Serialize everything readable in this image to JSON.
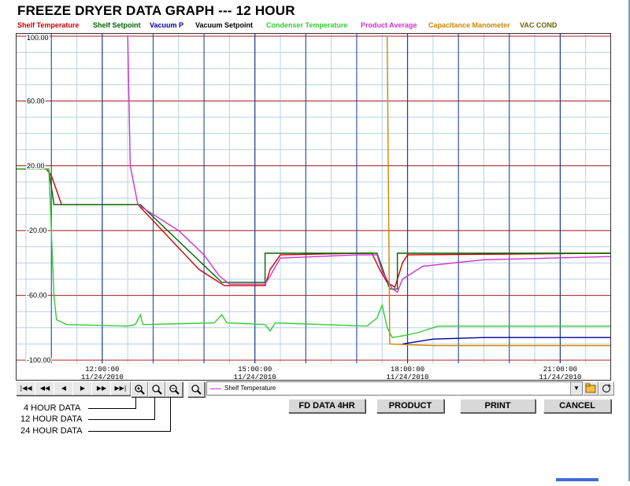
{
  "window": {
    "title": "FREEZE DRYER DATA GRAPH --- 12 HOUR"
  },
  "legend": [
    {
      "label": "Shelf Temperature",
      "color": "#cc0000"
    },
    {
      "label": "Shelf Setpoint",
      "color": "#006600"
    },
    {
      "label": "Vacuum P",
      "color": "#000099"
    },
    {
      "label": "Vacuum Setpoint",
      "color": "#000000"
    },
    {
      "label": "Condenser Temperature",
      "color": "#33cc33"
    },
    {
      "label": "Product Average",
      "color": "#cc33cc"
    },
    {
      "label": "Capacitance Manometer",
      "color": "#cc8800"
    },
    {
      "label": "VAC COND",
      "color": "#666600"
    }
  ],
  "chart_data": {
    "type": "line",
    "ylim": [
      -100,
      100
    ],
    "y_ticks": [
      "100.00",
      "60.00",
      "20.00",
      "-20.00",
      "-60.00",
      "-100.00"
    ],
    "x_ticks": [
      {
        "time": "12:00:00",
        "date": "11/24/2010"
      },
      {
        "time": "15:00:00",
        "date": "11/24/2010"
      },
      {
        "time": "18:00:00",
        "date": "11/24/2010"
      },
      {
        "time": "21:00:00",
        "date": "11/24/2010"
      }
    ],
    "xlim_hours": [
      10.3,
      22.0
    ],
    "grid": true,
    "series": [
      {
        "name": "Shelf Temperature",
        "color": "#cc0000",
        "points": [
          [
            10.3,
            18
          ],
          [
            10.9,
            18
          ],
          [
            11.0,
            14
          ],
          [
            11.2,
            -4
          ],
          [
            12.7,
            -4
          ],
          [
            13.9,
            -44
          ],
          [
            14.4,
            -54
          ],
          [
            15.2,
            -54
          ],
          [
            15.3,
            -44
          ],
          [
            15.5,
            -35
          ],
          [
            17.0,
            -34
          ],
          [
            17.3,
            -34
          ],
          [
            17.45,
            -44
          ],
          [
            17.6,
            -52
          ],
          [
            17.75,
            -55
          ],
          [
            17.9,
            -40
          ],
          [
            18.0,
            -35
          ],
          [
            22.0,
            -34
          ]
        ]
      },
      {
        "name": "Shelf Setpoint",
        "color": "#006600",
        "points": [
          [
            10.3,
            18
          ],
          [
            10.95,
            18
          ],
          [
            11.05,
            -4
          ],
          [
            12.75,
            -4
          ],
          [
            14.35,
            -52
          ],
          [
            15.2,
            -52
          ],
          [
            15.2,
            -34
          ],
          [
            17.4,
            -34
          ],
          [
            17.65,
            -56
          ],
          [
            17.8,
            -56
          ],
          [
            17.8,
            -34
          ],
          [
            22.0,
            -34
          ]
        ]
      },
      {
        "name": "Condenser Temperature",
        "color": "#33cc33",
        "points": [
          [
            10.3,
            18
          ],
          [
            10.95,
            18
          ],
          [
            11.05,
            -60
          ],
          [
            11.1,
            -75
          ],
          [
            11.3,
            -78
          ],
          [
            12.5,
            -79
          ],
          [
            12.65,
            -78
          ],
          [
            12.75,
            -72
          ],
          [
            12.8,
            -78
          ],
          [
            14.2,
            -77
          ],
          [
            14.35,
            -72
          ],
          [
            14.45,
            -77
          ],
          [
            15.2,
            -78
          ],
          [
            15.3,
            -82
          ],
          [
            15.4,
            -77
          ],
          [
            17.2,
            -79
          ],
          [
            17.4,
            -74
          ],
          [
            17.5,
            -66
          ],
          [
            17.6,
            -80
          ],
          [
            17.7,
            -86
          ],
          [
            17.9,
            -85
          ],
          [
            18.2,
            -83
          ],
          [
            18.6,
            -79
          ],
          [
            22.0,
            -79
          ]
        ]
      },
      {
        "name": "Product Average",
        "color": "#cc33cc",
        "points": [
          [
            12.5,
            100
          ],
          [
            12.55,
            20
          ],
          [
            12.7,
            -4
          ],
          [
            12.8,
            -6
          ],
          [
            13.5,
            -20
          ],
          [
            14.0,
            -35
          ],
          [
            14.3,
            -48
          ],
          [
            14.5,
            -53
          ],
          [
            15.2,
            -53
          ],
          [
            15.3,
            -48
          ],
          [
            15.5,
            -37
          ],
          [
            17.0,
            -35
          ],
          [
            17.4,
            -35
          ],
          [
            17.5,
            -45
          ],
          [
            17.7,
            -56
          ],
          [
            17.8,
            -58
          ],
          [
            17.9,
            -50
          ],
          [
            18.3,
            -42
          ],
          [
            19.5,
            -38
          ],
          [
            22.0,
            -36
          ]
        ]
      },
      {
        "name": "Vacuum P",
        "color": "#000099",
        "points": [
          [
            17.9,
            -90
          ],
          [
            18.5,
            -87
          ],
          [
            19.5,
            -86
          ],
          [
            21.0,
            -86
          ],
          [
            22.0,
            -86
          ]
        ]
      },
      {
        "name": "Capacitance Manometer",
        "color": "#cc8800",
        "points": [
          [
            17.6,
            100
          ],
          [
            17.65,
            -90
          ],
          [
            18.5,
            -91
          ],
          [
            22.0,
            -91
          ]
        ]
      }
    ]
  },
  "toolbar": {
    "nav_first": "|◀◀",
    "nav_prev_page": "◀◀",
    "nav_prev": "◀",
    "nav_next": "▶",
    "nav_next_page": "▶▶",
    "nav_last": "▶▶|",
    "series_selected": "Shelf Temperature",
    "dropdown_arrow": "▼"
  },
  "buttons": {
    "fd_data": "FD DATA 4HR",
    "product": "PRODUCT",
    "print": "PRINT",
    "cancel": "CANCEL"
  },
  "callouts": {
    "four_hour": "4 HOUR DATA",
    "twelve_hour": "12 HOUR DATA",
    "twentyfour_hour": "24 HOUR DATA"
  }
}
